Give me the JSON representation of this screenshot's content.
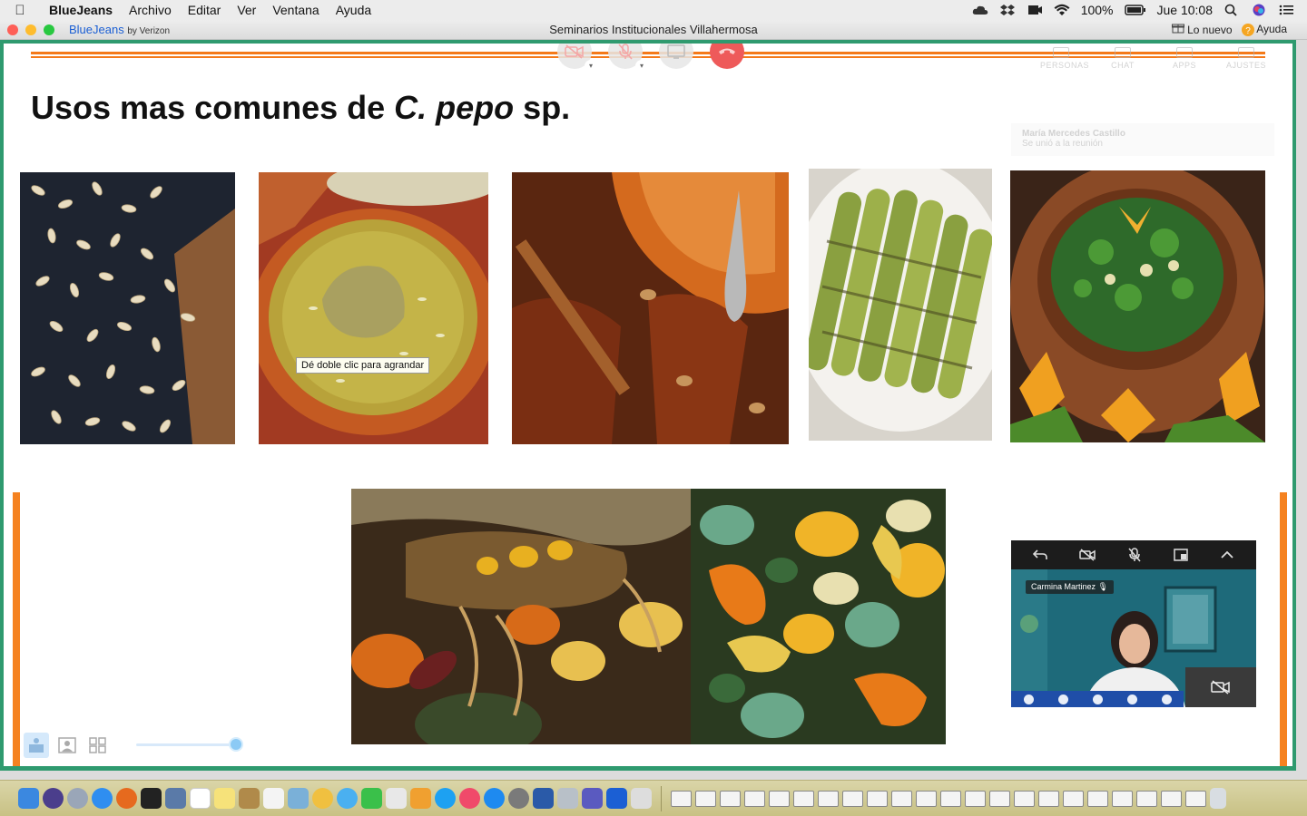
{
  "menubar": {
    "app_name": "BlueJeans",
    "items": [
      "Archivo",
      "Editar",
      "Ver",
      "Ventana",
      "Ayuda"
    ],
    "battery": "100%",
    "clock": "Jue 10:08"
  },
  "window": {
    "brand": "BlueJeans",
    "brand_suffix": "by Verizon",
    "title": "Seminarios Institucionales Villahermosa",
    "whats_new": "Lo nuevo",
    "help": "Ayuda"
  },
  "meeting": {
    "top_tabs": [
      "PERSONAS",
      "CHAT",
      "APPS",
      "AJUSTES"
    ],
    "ghost_name": "María Mercedes Castillo",
    "ghost_status": "Se unió a la reunión"
  },
  "slide": {
    "title_pre": "Usos mas comunes de ",
    "title_italic_1": "C.",
    "title_italic_2": "pepo",
    "title_post": " sp.",
    "tooltip": "Dé doble clic para agrandar"
  },
  "selfview": {
    "participant_name": "Carmina Martinez"
  },
  "colors": {
    "accent_orange": "#f58220",
    "frame_green": "#2f9a6f",
    "brand_blue": "#1b5fd4",
    "hangup_red": "#ee5a5a"
  }
}
